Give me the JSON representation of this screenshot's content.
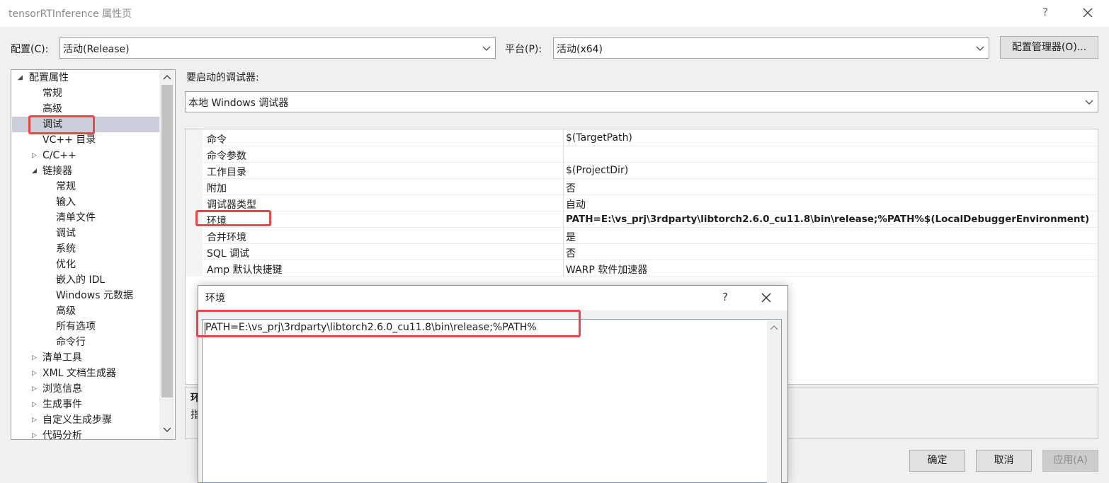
{
  "window": {
    "title": "tensorRTInference 属性页",
    "help": "?"
  },
  "toolbar": {
    "config_label": "配置(C):",
    "config_value": "活动(Release)",
    "platform_label": "平台(P):",
    "platform_value": "活动(x64)",
    "config_manager": "配置管理器(O)..."
  },
  "tree": {
    "root": "配置属性",
    "items": [
      "常规",
      "高级",
      "调试",
      "VC++ 目录",
      "C/C++",
      "链接器"
    ],
    "linker_children": [
      "常规",
      "输入",
      "清单文件",
      "调试",
      "系统",
      "优化",
      "嵌入的 IDL",
      "Windows 元数据",
      "高级",
      "所有选项",
      "命令行"
    ],
    "more": [
      "清单工具",
      "XML 文档生成器",
      "浏览信息",
      "生成事件",
      "自定义生成步骤",
      "代码分析"
    ],
    "selected": "调试"
  },
  "debugger": {
    "label": "要启动的调试器:",
    "value": "本地 Windows 调试器"
  },
  "properties": [
    {
      "name": "命令",
      "value": "$(TargetPath)"
    },
    {
      "name": "命令参数",
      "value": ""
    },
    {
      "name": "工作目录",
      "value": "$(ProjectDir)"
    },
    {
      "name": "附加",
      "value": "否"
    },
    {
      "name": "调试器类型",
      "value": "自动"
    },
    {
      "name": "环境",
      "value": "PATH=E:\\vs_prj\\3rdparty\\libtorch2.6.0_cu11.8\\bin\\release;%PATH%$(LocalDebuggerEnvironment)"
    },
    {
      "name": "合并环境",
      "value": "是"
    },
    {
      "name": "SQL 调试",
      "value": "否"
    },
    {
      "name": "Amp 默认快捷键",
      "value": "WARP 软件加速器"
    }
  ],
  "description": {
    "title_fragment": "环",
    "text_fragment": "指"
  },
  "buttons": {
    "ok": "确定",
    "cancel": "取消",
    "apply": "应用(A)"
  },
  "dialog": {
    "title": "环境",
    "help": "?",
    "text": "PATH=E:\\vs_prj\\3rdparty\\libtorch2.6.0_cu11.8\\bin\\release;%PATH%"
  },
  "colors": {
    "highlight": "#e8474a",
    "selection": "#cccedb"
  }
}
